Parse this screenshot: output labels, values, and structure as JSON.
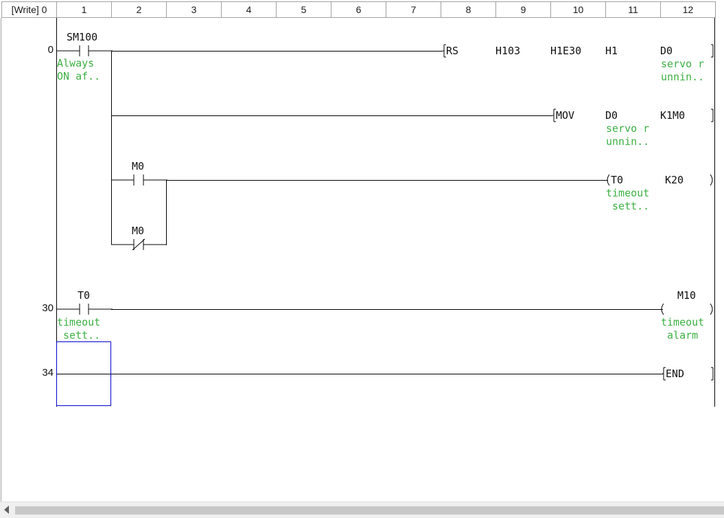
{
  "header": {
    "mode_label": "[Write] 0",
    "columns": [
      "1",
      "2",
      "3",
      "4",
      "5",
      "6",
      "7",
      "8",
      "9",
      "10",
      "11",
      "12"
    ]
  },
  "rungs": {
    "r0": {
      "step": "0",
      "contact_sm100": {
        "device": "SM100",
        "comment": "Always\nON af.."
      },
      "rs": {
        "instruction": "RS",
        "op1": "H103",
        "op2": "H1E30",
        "op3": "H1",
        "op4": "D0",
        "op4_comment": "servo r\nunnin.."
      },
      "mov": {
        "instruction": "MOV",
        "op1": "D0",
        "op1_comment": "servo r\nunnin..",
        "op2": "K1M0"
      },
      "contact_m0_no": {
        "device": "M0"
      },
      "contact_m0_nc": {
        "device": "M0"
      },
      "timer": {
        "instruction": "T0",
        "comment": "timeout\n sett..",
        "op": "K20"
      }
    },
    "r30": {
      "step": "30",
      "contact_t0": {
        "device": "T0",
        "comment": "timeout\n sett.."
      },
      "coil_m10": {
        "device": "M10",
        "comment": "timeout\n alarm"
      }
    },
    "r34": {
      "step": "34",
      "end": {
        "instruction": "END"
      }
    }
  },
  "colors": {
    "comment": "#3cb043",
    "cursor": "#0000cc",
    "wire": "#000000"
  }
}
